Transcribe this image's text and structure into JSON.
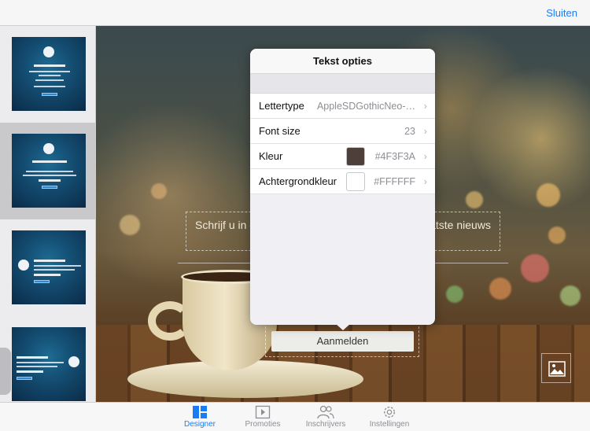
{
  "topbar": {
    "close_label": "Sluiten"
  },
  "canvas": {
    "intro_text_line1": "Schrijf u in om op de hoogte te blijven van het laatste nieuws",
    "intro_text_line2": "we              en.",
    "button_label": "Aanmelden",
    "image_icon": "photo-icon"
  },
  "popover": {
    "title": "Tekst opties",
    "rows": [
      {
        "label": "Lettertype",
        "value": "AppleSDGothicNeo-…"
      },
      {
        "label": "Font size",
        "value": "23"
      },
      {
        "label": "Kleur",
        "value": "#4F3F3A",
        "swatch": "#4F3F3A"
      },
      {
        "label": "Achtergrondkleur",
        "value": "#FFFFFF",
        "swatch": "#FFFFFF"
      }
    ]
  },
  "tabs": [
    {
      "label": "Designer",
      "icon": "designer-icon",
      "active": true
    },
    {
      "label": "Promoties",
      "icon": "play-icon",
      "active": false
    },
    {
      "label": "Inschrijvers",
      "icon": "people-icon",
      "active": false
    },
    {
      "label": "Instellingen",
      "icon": "gear-icon",
      "active": false
    }
  ],
  "colors": {
    "accent": "#1A7CF5"
  }
}
